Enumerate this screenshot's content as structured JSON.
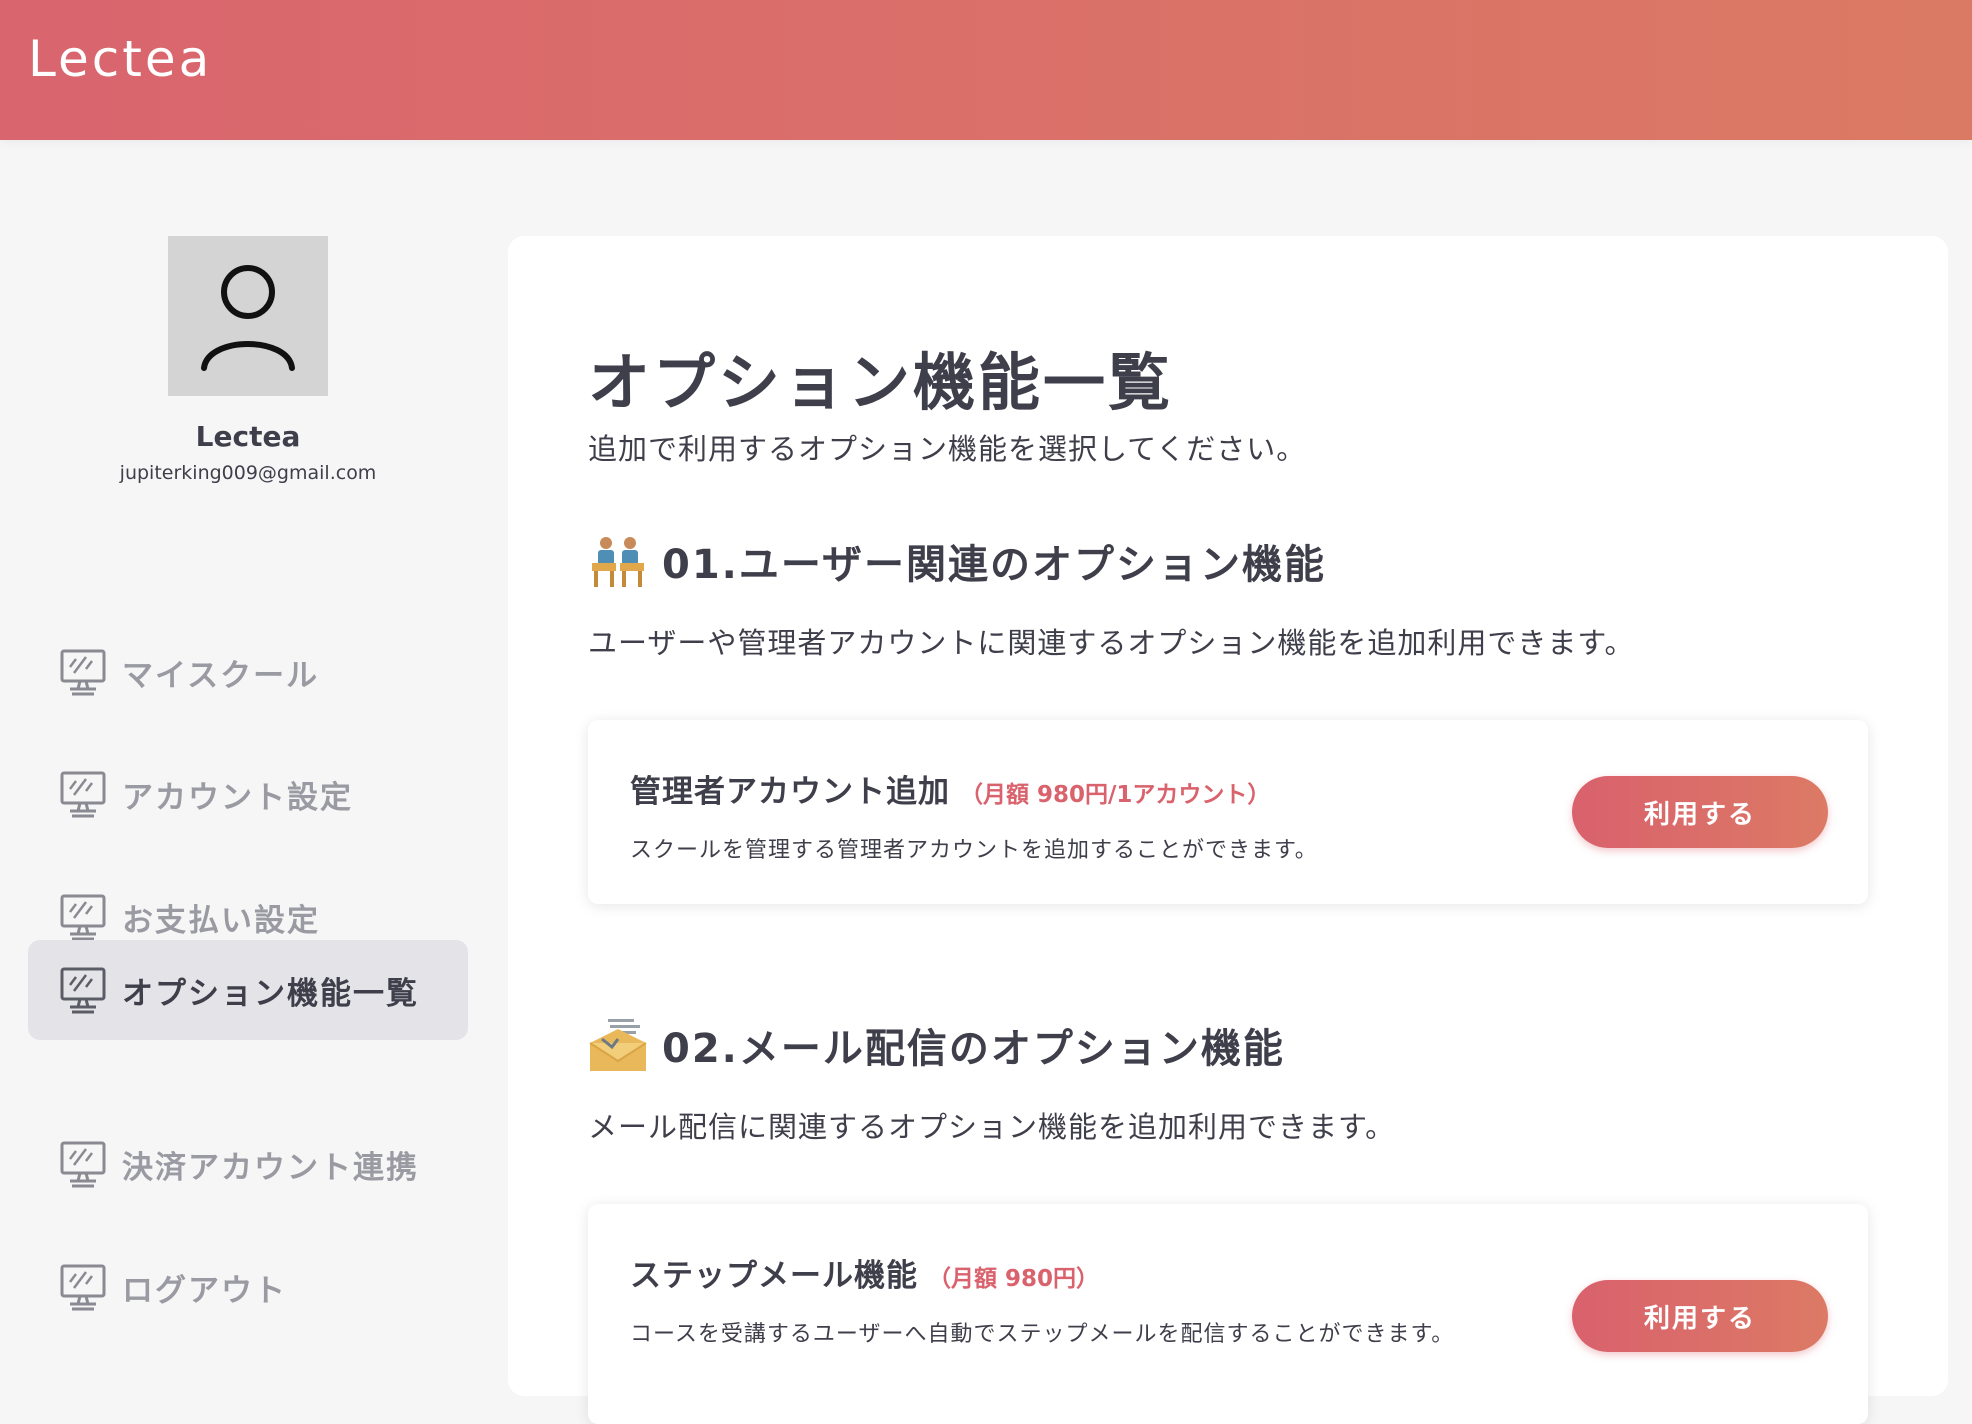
{
  "header": {
    "logo": "Lectea"
  },
  "user": {
    "name": "Lectea",
    "email": "jupiterking009@gmail.com"
  },
  "sidebar": {
    "items": [
      {
        "label": "マイスクール",
        "icon": "monitor-icon",
        "active": false
      },
      {
        "label": "アカウント設定",
        "icon": "monitor-icon",
        "active": false
      },
      {
        "label": "お支払い設定",
        "icon": "monitor-icon",
        "active": false
      },
      {
        "label": "オプション機能一覧",
        "icon": "monitor-icon",
        "active": true
      },
      {
        "label": "決済アカウント連携",
        "icon": "monitor-icon",
        "active": false
      },
      {
        "label": "ログアウト",
        "icon": "monitor-icon",
        "active": false
      }
    ]
  },
  "main": {
    "title": "オプション機能一覧",
    "subtitle": "追加で利用するオプション機能を選択してください。",
    "sections": [
      {
        "icon": "users-at-desks-icon",
        "title": "01.ユーザー関連のオプション機能",
        "description": "ユーザーや管理者アカウントに関連するオプション機能を追加利用できます。",
        "options": [
          {
            "title": "管理者アカウント追加",
            "price": "（月額 980円/1アカウント）",
            "description": "スクールを管理する管理者アカウントを追加することができます。",
            "button_label": "利用する"
          }
        ]
      },
      {
        "icon": "envelope-icon",
        "title": "02.メール配信のオプション機能",
        "description": "メール配信に関連するオプション機能を追加利用できます。",
        "options": [
          {
            "title": "ステップメール機能",
            "price": "（月額 980円）",
            "description": "コースを受講するユーザーへ自動でステップメールを配信することができます。",
            "button_label": "利用する"
          }
        ]
      }
    ]
  },
  "colors": {
    "accent_start": "#d9616d",
    "accent_end": "#dc7a65",
    "price_text": "#d9626c",
    "text_dark": "#3f3f4b",
    "nav_inactive": "#9a9aa2"
  }
}
